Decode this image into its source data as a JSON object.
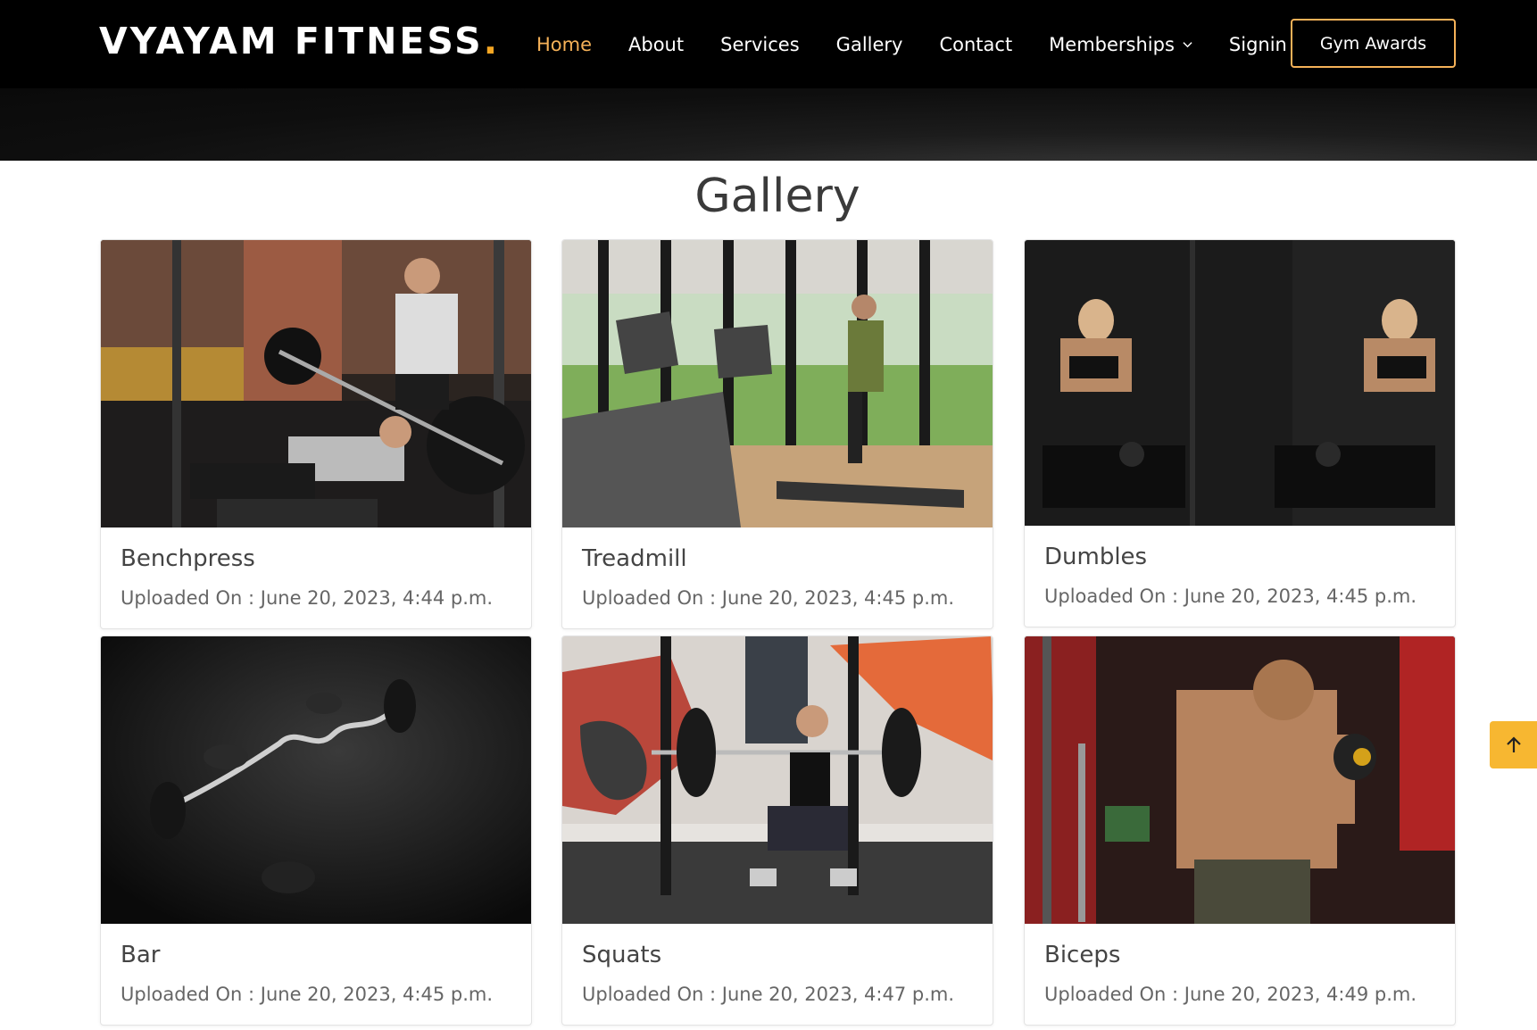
{
  "header": {
    "logo_text": "VYAYAM FITNESS",
    "logo_dot": ".",
    "nav": [
      {
        "label": "Home",
        "active": true
      },
      {
        "label": "About",
        "active": false
      },
      {
        "label": "Services",
        "active": false
      },
      {
        "label": "Gallery",
        "active": false
      },
      {
        "label": "Contact",
        "active": false
      },
      {
        "label": "Memberships",
        "active": false,
        "dropdown": true
      },
      {
        "label": "Signin",
        "active": false
      }
    ],
    "cta_label": "Gym Awards"
  },
  "gallery": {
    "title": "Gallery",
    "items": [
      {
        "title": "Benchpress",
        "uploaded": "Uploaded On : June 20, 2023, 4:44 p.m."
      },
      {
        "title": "Treadmill",
        "uploaded": "Uploaded On : June 20, 2023, 4:45 p.m."
      },
      {
        "title": "Dumbles",
        "uploaded": "Uploaded On : June 20, 2023, 4:45 p.m."
      },
      {
        "title": "Bar",
        "uploaded": "Uploaded On : June 20, 2023, 4:45 p.m."
      },
      {
        "title": "Squats",
        "uploaded": "Uploaded On : June 20, 2023, 4:47 p.m."
      },
      {
        "title": "Biceps",
        "uploaded": "Uploaded On : June 20, 2023, 4:49 p.m."
      }
    ]
  },
  "colors": {
    "accent": "#f5b158",
    "header_bg": "#000000",
    "back_to_top": "#f7b731"
  },
  "icons": {
    "dropdown": "chevron-down-icon",
    "back_to_top": "arrow-up-icon"
  }
}
